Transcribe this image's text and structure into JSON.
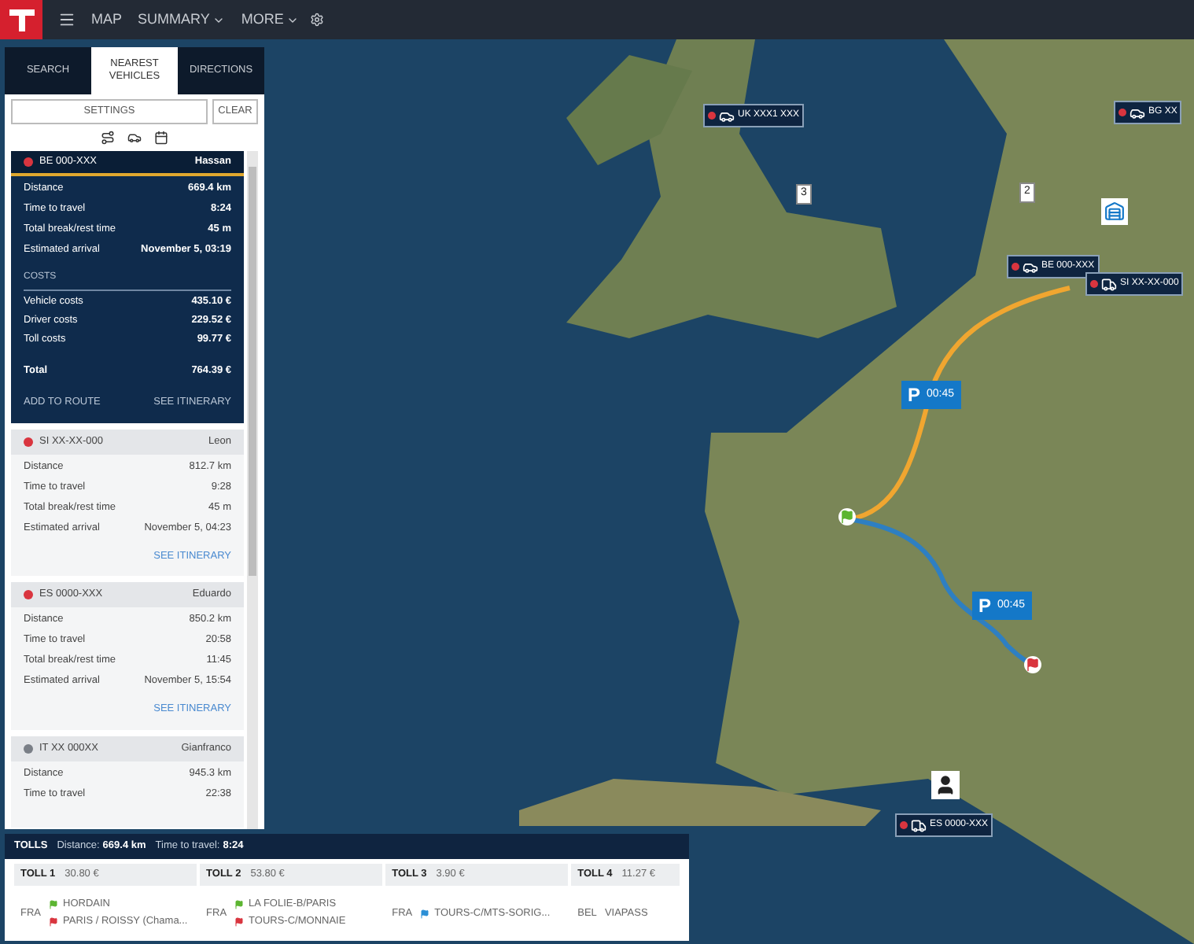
{
  "nav": {
    "items": [
      {
        "label": "MAP",
        "dropdown": false
      },
      {
        "label": "SUMMARY",
        "dropdown": true
      },
      {
        "label": "MORE",
        "dropdown": true
      }
    ]
  },
  "sidebar": {
    "tabs": [
      {
        "label": "SEARCH",
        "selected": false
      },
      {
        "label": "NEAREST VEHICLES",
        "selected": true
      },
      {
        "label": "DIRECTIONS",
        "selected": false
      }
    ],
    "settings_button": "SETTINGS",
    "clear_button": "CLEAR",
    "vehicles": [
      {
        "plate": "BE 000-XXX",
        "driver": "Hassan",
        "color": "#d9353f",
        "selected": true,
        "rows": [
          {
            "label": "Distance",
            "value": "669.4 km"
          },
          {
            "label": "Time to travel",
            "value": "8:24"
          },
          {
            "label": "Total break/rest time",
            "value": "45 m"
          },
          {
            "label": "Estimated arrival",
            "value": "November 5, 03:19"
          }
        ],
        "costs_title": "COSTS",
        "costs": [
          {
            "label": "Vehicle costs",
            "value": "435.10 €"
          },
          {
            "label": "Driver costs",
            "value": "229.52 €"
          },
          {
            "label": "Toll costs",
            "value": "99.77 €"
          }
        ],
        "total": {
          "label": "Total",
          "value": "764.39 €"
        },
        "add_link": "ADD TO ROUTE",
        "itinerary_link": "SEE ITINERARY"
      },
      {
        "plate": "SI XX-XX-000",
        "driver": "Leon",
        "color": "#d9353f",
        "selected": false,
        "rows": [
          {
            "label": "Distance",
            "value": "812.7 km"
          },
          {
            "label": "Time to travel",
            "value": "9:28"
          },
          {
            "label": "Total break/rest time",
            "value": "45 m"
          },
          {
            "label": "Estimated arrival",
            "value": "November 5, 04:23"
          }
        ],
        "itinerary_link": "SEE ITINERARY"
      },
      {
        "plate": "ES 0000-XXX",
        "driver": "Eduardo",
        "color": "#d9353f",
        "selected": false,
        "rows": [
          {
            "label": "Distance",
            "value": "850.2 km"
          },
          {
            "label": "Time to travel",
            "value": "20:58"
          },
          {
            "label": "Total break/rest time",
            "value": "11:45"
          },
          {
            "label": "Estimated arrival",
            "value": "November 5, 15:54"
          }
        ],
        "itinerary_link": "SEE ITINERARY"
      },
      {
        "plate": "IT XX 000XX",
        "driver": "Gianfranco",
        "color": "#7a7f87",
        "selected": false,
        "rows": [
          {
            "label": "Distance",
            "value": "945.3 km"
          },
          {
            "label": "Time to travel",
            "value": "22:38"
          }
        ]
      }
    ]
  },
  "map": {
    "markers": [
      {
        "kind": "vehicle",
        "label": "UK XXX1 XXX"
      },
      {
        "kind": "vehicle",
        "label": "BG XX"
      },
      {
        "kind": "vehicle",
        "label": "BE 000-XXX"
      },
      {
        "kind": "truck",
        "label": "SI XX-XX-000"
      },
      {
        "kind": "truck",
        "label": "ES 0000-XXX"
      },
      {
        "kind": "parking",
        "symbol": "P",
        "label": "00:45"
      },
      {
        "kind": "parking",
        "symbol": "P",
        "label": "00:45"
      },
      {
        "kind": "number",
        "label": "3"
      },
      {
        "kind": "number",
        "label": "2"
      },
      {
        "kind": "depot"
      },
      {
        "kind": "person"
      },
      {
        "kind": "start"
      },
      {
        "kind": "end"
      }
    ]
  },
  "tolls": {
    "title": "TOLLS",
    "distance_label": "Distance:",
    "distance": "669.4 km",
    "time_label": "Time to travel:",
    "time": "8:24",
    "items": [
      {
        "name": "TOLL 1",
        "amount": "30.80 €",
        "country": "FRA",
        "points": [
          {
            "name": "HORDAIN",
            "color": "#5cb531"
          },
          {
            "name": "PARIS / ROISSY (Chama...",
            "color": "#d9353f"
          }
        ]
      },
      {
        "name": "TOLL 2",
        "amount": "53.80 €",
        "country": "FRA",
        "points": [
          {
            "name": "LA FOLIE-B/PARIS",
            "color": "#5cb531"
          },
          {
            "name": "TOURS-C/MONNAIE",
            "color": "#d9353f"
          }
        ]
      },
      {
        "name": "TOLL 3",
        "amount": "3.90 €",
        "country": "FRA",
        "points": [
          {
            "name": "TOURS-C/MTS-SORIG...",
            "color": "#2b8fd6"
          }
        ]
      },
      {
        "name": "TOLL 4",
        "amount": "11.27 €",
        "country": "BEL",
        "points": [
          {
            "name": "VIAPASS"
          }
        ]
      }
    ]
  }
}
